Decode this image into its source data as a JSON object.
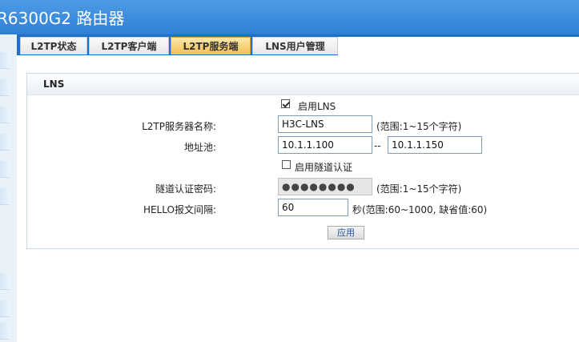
{
  "window": {
    "title": "R6300G2 路由器"
  },
  "tabs": [
    {
      "label": "L2TP状态"
    },
    {
      "label": "L2TP客户端"
    },
    {
      "label": "L2TP服务端",
      "active": true
    },
    {
      "label": "LNS用户管理"
    }
  ],
  "panel": {
    "title": "LNS"
  },
  "form": {
    "enable_lns": {
      "label": "启用LNS",
      "checked": true
    },
    "server_name": {
      "label": "L2TP服务器名称:",
      "value": "H3C-LNS",
      "hint": "(范围:1~15个字符)"
    },
    "address_pool": {
      "label": "地址池:",
      "start": "10.1.1.100",
      "separator": "--",
      "end": "10.1.1.150"
    },
    "tunnel_auth": {
      "label": "启用隧道认证",
      "checked": false
    },
    "tunnel_password": {
      "label": "隧道认证密码:",
      "value": "●●●●●●●●",
      "hint": "(范围:1~15个字符)",
      "disabled": true
    },
    "hello_interval": {
      "label": "HELLO报文间隔:",
      "value": "60",
      "hint": "秒(范围:60~1000, 缺省值:60)"
    },
    "apply_button": "应用"
  },
  "colors": {
    "titlebar": "#3a88dd",
    "tabbar": "#1f6fc9",
    "active_tab": "#f3c04c"
  }
}
